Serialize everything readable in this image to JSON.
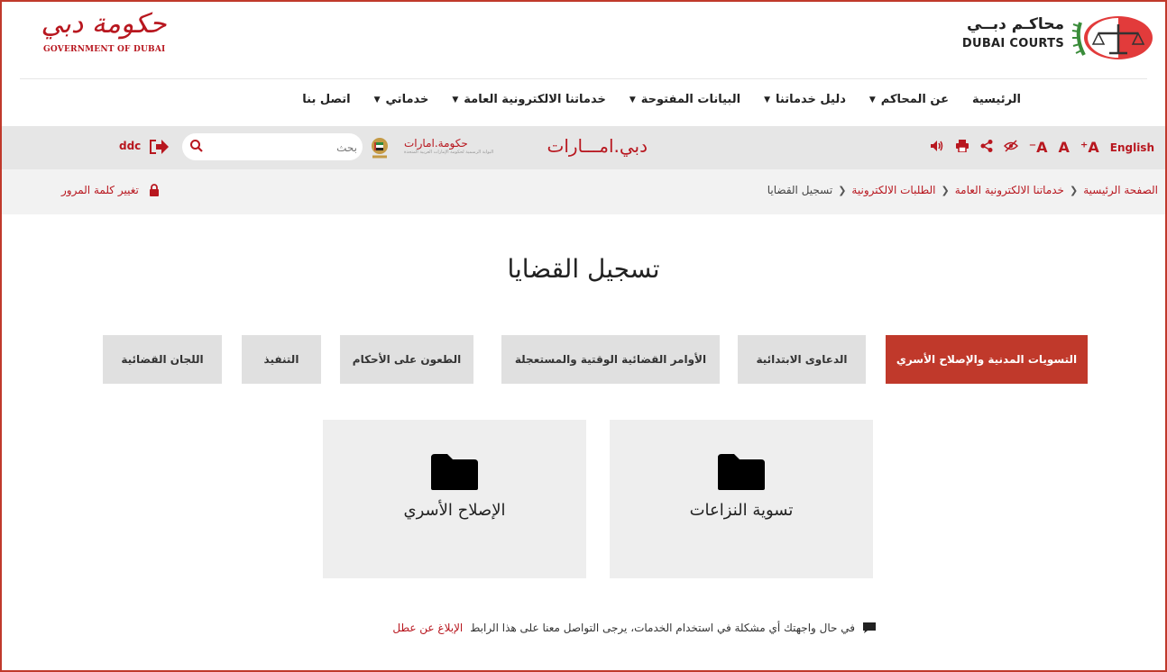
{
  "header": {
    "gov_logo_script": "حكومة دبي",
    "gov_logo_text": "GOVERNMENT OF DUBAI",
    "courts_logo_ar": "محاكـم دبــي",
    "courts_logo_en": "DUBAI COURTS"
  },
  "nav": {
    "items": [
      {
        "label": "الرئيسية",
        "has_dropdown": false
      },
      {
        "label": "عن المحاكم",
        "has_dropdown": true
      },
      {
        "label": "دليل خدماتنا",
        "has_dropdown": true
      },
      {
        "label": "البيانات المفتوحة",
        "has_dropdown": true
      },
      {
        "label": "خدماتنا الالكترونية العامة",
        "has_dropdown": true
      },
      {
        "label": "خدماتي",
        "has_dropdown": true
      },
      {
        "label": "اتصل بنا",
        "has_dropdown": false
      }
    ]
  },
  "util": {
    "english": "English",
    "font_increase": "⁺A",
    "font_normal": "A",
    "font_decrease": "⁻A",
    "dubai_emarat": "دبي.امـــارات",
    "gov_emarat": "حكومة.امارات",
    "gov_emarat_sub": "البوابة الرسمية لحكومة الإمارات العربية المتحدة",
    "search_placeholder": "بحث",
    "user": "ddc"
  },
  "breadcrumb": {
    "items": [
      "الصفحة الرئيسية",
      "خدماتنا الالكترونية العامة",
      "الطلبات الالكترونية"
    ],
    "current": "تسجيل القضايا"
  },
  "change_password": "تغيير كلمة المرور",
  "page_title": "تسجيل القضايا",
  "tabs": [
    {
      "label": "التسويات المدنية والإصلاح الأسري",
      "active": true
    },
    {
      "label": "الدعاوى الابتدائية",
      "active": false
    },
    {
      "label": "الأوامر القضائية الوقتية والمستعجلة",
      "active": false
    },
    {
      "label": "الطعون على الأحكام",
      "active": false
    },
    {
      "label": "التنفيذ",
      "active": false
    },
    {
      "label": "اللجان القضائية",
      "active": false
    }
  ],
  "cards": [
    {
      "label": "تسوية النزاعات",
      "icon": "folder-icon"
    },
    {
      "label": "الإصلاح الأسري",
      "icon": "folder-icon"
    }
  ],
  "notice": {
    "text": "في حال واجهتك أي مشكلة في استخدام الخدمات، يرجى التواصل معنا على هذا الرابط",
    "link": "الإبلاغ عن عطل"
  },
  "colors": {
    "accent": "#b8171f",
    "active_tab": "#c0392b",
    "tab_bg": "#e0e0e0",
    "card_bg": "#eeeeee",
    "util_bar": "#e6e6e6"
  }
}
